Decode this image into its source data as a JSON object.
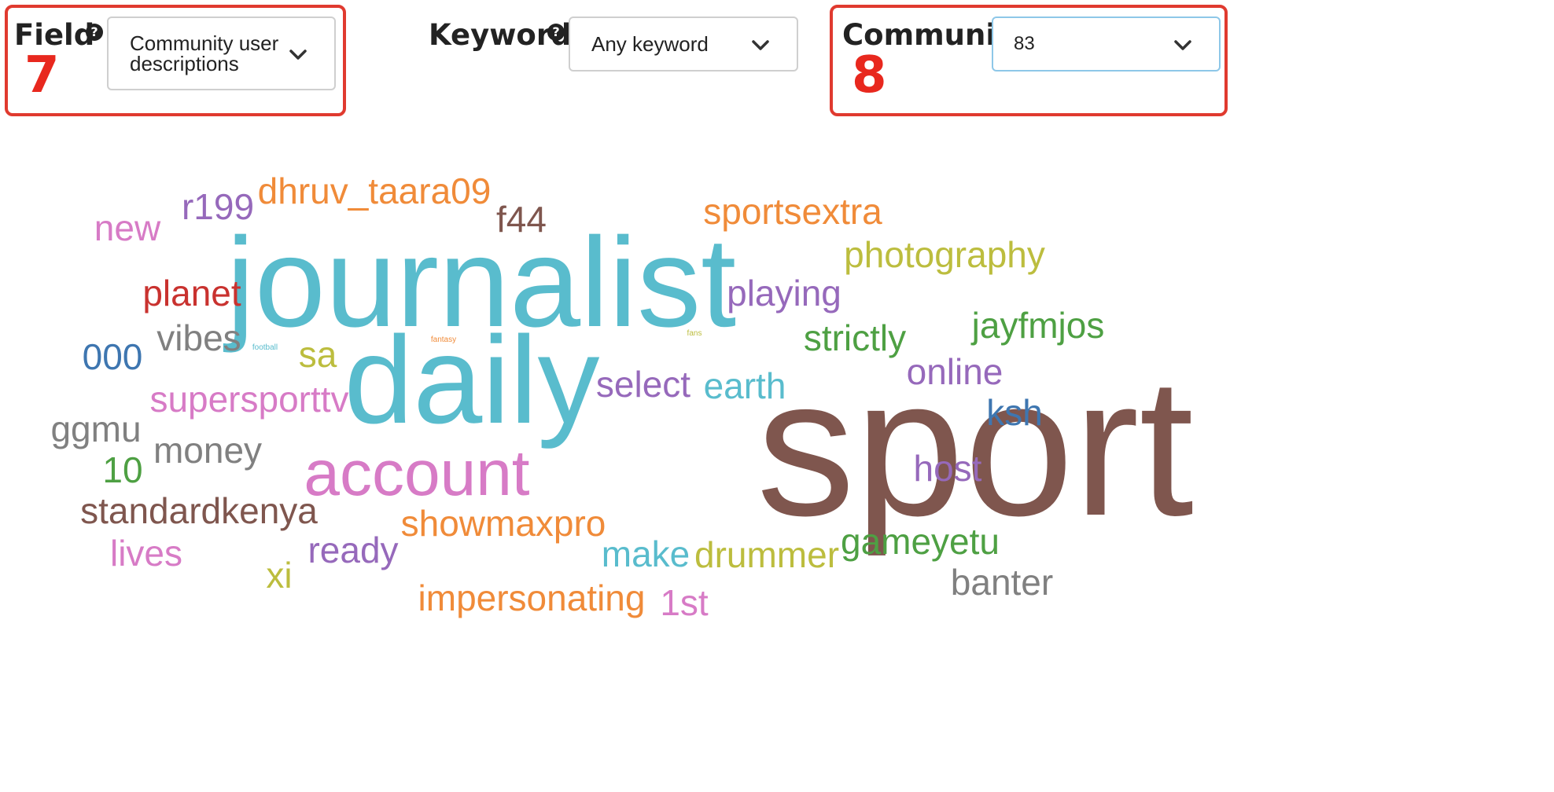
{
  "controls": {
    "field": {
      "label": "Field",
      "help": "?",
      "value": "Community user descriptions",
      "marker": "7"
    },
    "keyword": {
      "label": "Keyword",
      "help": "?",
      "value": "Any keyword"
    },
    "community": {
      "label": "Community",
      "value": "83",
      "marker": "8"
    }
  },
  "colors": {
    "marker": "#e8281e",
    "select_border": "#cfcfcf",
    "select_focus_border": "#8ec7e8"
  },
  "wordcloud": {
    "words": [
      {
        "text": "sport",
        "color": "#7f564e"
      },
      {
        "text": "journalist",
        "color": "#59bccd"
      },
      {
        "text": "daily",
        "color": "#59bccd"
      },
      {
        "text": "account",
        "color": "#d77bc6"
      },
      {
        "text": "dhruv_taara09",
        "color": "#f08b39"
      },
      {
        "text": "r199",
        "color": "#9669bb"
      },
      {
        "text": "f44",
        "color": "#7f564e"
      },
      {
        "text": "sportsextra",
        "color": "#f08b39"
      },
      {
        "text": "new",
        "color": "#d77bc6"
      },
      {
        "text": "photography",
        "color": "#bcbd3e"
      },
      {
        "text": "planet",
        "color": "#c9322f"
      },
      {
        "text": "playing",
        "color": "#9669bb"
      },
      {
        "text": "vibes",
        "color": "#808080"
      },
      {
        "text": "strictly",
        "color": "#4ea043"
      },
      {
        "text": "jayfmjos",
        "color": "#4ea043"
      },
      {
        "text": "000",
        "color": "#3e76b0"
      },
      {
        "text": "sa",
        "color": "#bcbd3e"
      },
      {
        "text": "online",
        "color": "#9669bb"
      },
      {
        "text": "select",
        "color": "#9669bb"
      },
      {
        "text": "earth",
        "color": "#59bccd"
      },
      {
        "text": "supersporttv",
        "color": "#d77bc6"
      },
      {
        "text": "ksh",
        "color": "#3e76b0"
      },
      {
        "text": "ggmu",
        "color": "#808080"
      },
      {
        "text": "money",
        "color": "#808080"
      },
      {
        "text": "10",
        "color": "#4ea043"
      },
      {
        "text": "host",
        "color": "#9669bb"
      },
      {
        "text": "standardkenya",
        "color": "#7f564e"
      },
      {
        "text": "showmaxpro",
        "color": "#f08b39"
      },
      {
        "text": "gameyetu",
        "color": "#4ea043"
      },
      {
        "text": "lives",
        "color": "#d77bc6"
      },
      {
        "text": "ready",
        "color": "#9669bb"
      },
      {
        "text": "make",
        "color": "#59bccd"
      },
      {
        "text": "drummer",
        "color": "#bcbd3e"
      },
      {
        "text": "xi",
        "color": "#bcbd3e"
      },
      {
        "text": "banter",
        "color": "#808080"
      },
      {
        "text": "impersonating",
        "color": "#f08b39"
      },
      {
        "text": "1st",
        "color": "#d77bc6"
      },
      {
        "text": "football",
        "color": "#59bccd"
      },
      {
        "text": "fantasy",
        "color": "#f08b39"
      },
      {
        "text": "fans",
        "color": "#bcbd3e"
      }
    ]
  }
}
